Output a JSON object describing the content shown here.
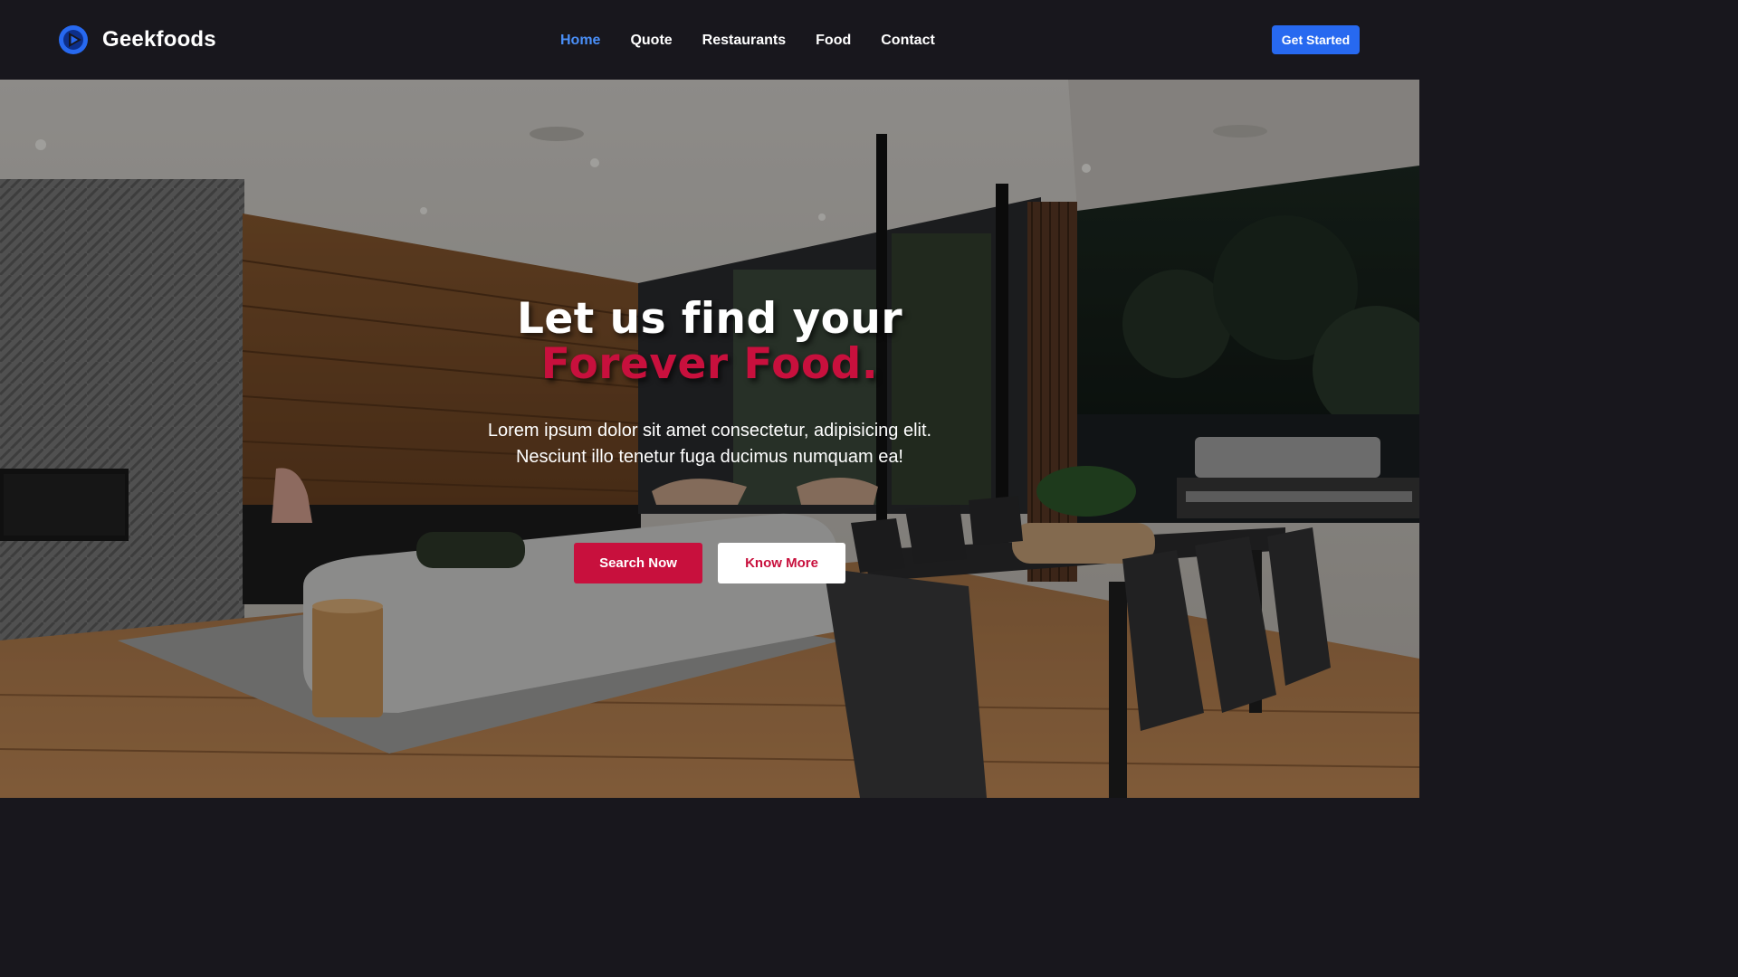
{
  "brand": {
    "name": "Geekfoods",
    "logo_icon": "play-logo-icon",
    "logo_color": "#2769f0"
  },
  "nav": {
    "items": [
      {
        "label": "Home",
        "active": true
      },
      {
        "label": "Quote",
        "active": false
      },
      {
        "label": "Restaurants",
        "active": false
      },
      {
        "label": "Food",
        "active": false
      },
      {
        "label": "Contact",
        "active": false
      }
    ],
    "cta_label": "Get Started"
  },
  "hero": {
    "title_line1": "Let us find your",
    "title_line2": "Forever Food.",
    "subtitle_line1": "Lorem ipsum dolor sit amet consectetur, adipisicing elit.",
    "subtitle_line2": "Nesciunt illo tenetur fuga ducimus numquam ea!",
    "primary_button": "Search Now",
    "secondary_button": "Know More",
    "accent_color": "#c8103d"
  }
}
